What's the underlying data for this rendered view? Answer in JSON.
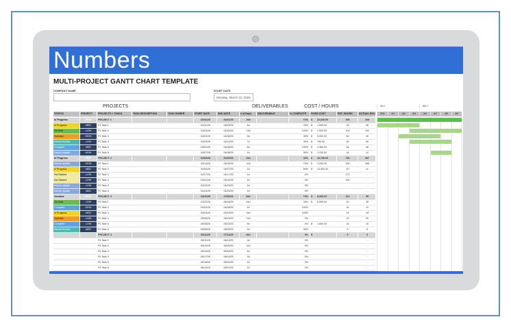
{
  "brand": {
    "title": "Numbers",
    "accent": "#2f6fd6"
  },
  "sheet": {
    "title": "MULTI-PROJECT GANTT CHART TEMPLATE",
    "company_label": "COMPANY NAME",
    "start_date_label": "START DATE",
    "start_date_value": "Monday, March 31, 2025"
  },
  "sections": {
    "projects": "PROJECTS",
    "deliverables": "DELIVERABLES",
    "cost_hours": "COST / HOURS"
  },
  "headers": [
    "STATUS",
    "PRIORITY",
    "PROJECTS + TASKS",
    "TASK DESCRIPTION",
    "TASK OWNER",
    "START DATE",
    "END DATE",
    "# of Days",
    "DELIVERABLE",
    "% COMPLETE",
    "FIXED COST",
    "EST. HOURS",
    "ACTUAL HOURS"
  ],
  "weeks": [
    "Wk 1",
    "Wk 2"
  ],
  "days": [
    "3/31",
    "4/1",
    "4/2",
    "4/3",
    "4/4",
    "4/7",
    "4/8",
    "4/9"
  ],
  "rows": [
    {
      "type": "project",
      "status": "In Progress",
      "st": "inprog",
      "priority": "HIGH",
      "name": "PROJECT 1",
      "start": "03/31/25",
      "end": "04/21/25",
      "days": "16d",
      "pct": "74%",
      "cur": "$",
      "cost": "22,630.00",
      "est": "306",
      "act": "298"
    },
    {
      "type": "task",
      "status": "In Progress",
      "st": "inprog",
      "priority": "MED",
      "name": "P1 Task 1",
      "start": "03/31/25",
      "end": "04/03/25",
      "days": "4d",
      "pct": "33%",
      "cur": "$",
      "cost": "1,500.00",
      "est": "32",
      "act": "36"
    },
    {
      "type": "task",
      "status": "On Hold",
      "st": "onhold",
      "priority": "LOW",
      "name": "P1 Task 2",
      "start": "04/03/25",
      "end": "04/20/25",
      "days": "13d",
      "pct": "100%",
      "cur": "$",
      "cost": "2,000.00",
      "est": "104",
      "act": "100"
    },
    {
      "type": "task",
      "status": "Overdue",
      "st": "overdue",
      "priority": "HIGH",
      "name": "P1 Task 3",
      "start": "04/02/25",
      "end": "04/08/25",
      "days": "5d",
      "pct": "90%",
      "cur": "$",
      "cost": "5,000.00",
      "est": "40",
      "act": "40"
    },
    {
      "type": "task",
      "status": "Needs Review",
      "st": "review",
      "priority": "LOW",
      "name": "P1 Task 4",
      "start": "04/03/25",
      "end": "04/12/25",
      "days": "7d",
      "pct": "33%",
      "cur": "$",
      "cost": "750.00",
      "est": "50",
      "act": "56"
    },
    {
      "type": "task",
      "status": "Complete",
      "st": "complete",
      "priority": "MED",
      "name": "P1 Task 5",
      "start": "04/02/25",
      "end": "04/08/25",
      "days": "8d",
      "pct": "100%",
      "cur": "$",
      "cost": "4,380.00",
      "est": "64",
      "act": "56"
    },
    {
      "type": "task",
      "status": "Needs Update",
      "st": "update",
      "priority": "HIGH",
      "name": "P1 Task 6",
      "start": "04/07/25",
      "end": "04/08/25",
      "days": "2d",
      "pct": "90%",
      "cur": "$",
      "cost": "1,200.00",
      "est": "16",
      "act": "10"
    },
    {
      "type": "project",
      "status": "In Progress",
      "st": "inprog",
      "priority": "MED",
      "name": "PROJECT 2",
      "start": "04/04/25",
      "end": "04/25/25",
      "days": "16d",
      "pct": "32%",
      "cur": "$",
      "cost": "16,700.00",
      "est": "792",
      "act": "367"
    },
    {
      "type": "task",
      "status": "Needs Update",
      "st": "update",
      "priority": "HIGH",
      "name": "P2 Task 1",
      "start": "04/14/25",
      "end": "04/25/25",
      "days": "10d",
      "pct": "75%",
      "cur": "$",
      "cost": "2,200.00",
      "est": "200",
      "act": "356"
    },
    {
      "type": "task",
      "status": "In Progress",
      "st": "inprog",
      "priority": "MED",
      "name": "P2 Task 2",
      "start": "04/04/25",
      "end": "04/07/25",
      "days": "2d",
      "pct": "60%",
      "cur": "$",
      "cost": "14,500.00",
      "est": "20",
      "act": "11"
    },
    {
      "type": "task",
      "status": "Not Started",
      "st": "notstarted",
      "priority": "LOW",
      "name": "P2 Task 3",
      "start": "04/17/25",
      "end": "04/17/25",
      "days": "1d",
      "pct": "0%",
      "cur": "",
      "cost": "",
      "est": "272",
      "act": "-"
    },
    {
      "type": "task",
      "status": "Not Started",
      "st": "notstarted",
      "priority": "LOW",
      "name": "P2 Task 4",
      "start": "04/21/25",
      "end": "04/24/25",
      "days": "4d",
      "pct": "0%",
      "cur": "",
      "cost": "",
      "est": "150",
      "act": "-"
    },
    {
      "type": "task",
      "status": "Needs Update",
      "st": "update",
      "priority": "LOW",
      "name": "P2 Task 5",
      "start": "04/22/25",
      "end": "04/23/25",
      "days": "2d",
      "pct": "0%",
      "cur": "",
      "cost": "",
      "est": "",
      "act": "-"
    },
    {
      "type": "task",
      "status": "Needs Update",
      "st": "update",
      "priority": "MED",
      "name": "P2 Task 6",
      "start": "04/24/25",
      "end": "04/25/25",
      "days": "2d",
      "pct": "0%",
      "cur": "",
      "cost": "",
      "est": "",
      "act": "-"
    },
    {
      "type": "project",
      "status": "Overdue",
      "st": "overdue",
      "priority": "HIGH",
      "name": "PROJECT 3",
      "start": "04/22/25",
      "end": "07/02/25",
      "days": "52d",
      "pct": "74%",
      "cur": "$",
      "cost": "8,300.00",
      "est": "112",
      "act": "99"
    },
    {
      "type": "task",
      "status": "On Hold",
      "st": "onhold",
      "priority": "LOW",
      "name": "P3 Task 1",
      "start": "04/22/25",
      "end": "06/18/25",
      "days": "44d",
      "pct": "33%",
      "cur": "$",
      "cost": "6,500.00",
      "est": "40",
      "act": "36"
    },
    {
      "type": "task",
      "status": "Complete",
      "st": "complete",
      "priority": "HIGH",
      "name": "P3 Task 2",
      "start": "04/03/25",
      "end": "04/08/25",
      "days": "2d",
      "pct": "100%",
      "cur": "",
      "cost": "",
      "est": "16",
      "act": "12"
    },
    {
      "type": "task",
      "status": "In Progress",
      "st": "inprog",
      "priority": "MED",
      "name": "P3 Task 3",
      "start": "04/04/25",
      "end": "05/19/25",
      "days": "34d",
      "pct": "100%",
      "cur": "",
      "cost": "",
      "est": "24",
      "act": "18"
    },
    {
      "type": "task",
      "status": "Overdue",
      "st": "overdue",
      "priority": "LOW",
      "name": "P3 Task 4",
      "start": "05/06/25",
      "end": "05/03/25",
      "days": "21d",
      "pct": "0%",
      "cur": "",
      "cost": "",
      "est": "32",
      "act": "32"
    },
    {
      "type": "task",
      "status": "Complete",
      "st": "complete",
      "priority": "LOW",
      "name": "P3 Task 5",
      "start": "05/08/25",
      "end": "05/23/25",
      "days": "5d",
      "pct": "0%",
      "cur": "$",
      "cost": "1,800.00",
      "est": "16",
      "act": "16"
    },
    {
      "type": "task",
      "status": "Needs Review",
      "st": "review",
      "priority": "MED",
      "name": "P3 Task 6",
      "start": "06/08/25",
      "end": "06/08/25",
      "days": "3d",
      "pct": "90%",
      "cur": "",
      "cost": "",
      "est": "5",
      "act": "8"
    },
    {
      "type": "project",
      "status": "",
      "st": "",
      "priority": "",
      "name": "PROJECT 4",
      "start": "06/11/25",
      "end": "07/14/25",
      "days": "46d",
      "pct": "0%",
      "cur": "$",
      "cost": "-",
      "est": "0",
      "act": "0"
    },
    {
      "type": "task",
      "status": "",
      "st": "",
      "priority": "",
      "name": "P4 Task 1",
      "start": "06/11/25",
      "end": "06/13/25",
      "days": "3d",
      "pct": "0%",
      "cur": "",
      "cost": "",
      "est": "",
      "act": "-"
    },
    {
      "type": "task",
      "status": "",
      "st": "",
      "priority": "",
      "name": "P4 Task 2",
      "start": "06/13/25",
      "end": "06/26/25",
      "days": "10d",
      "pct": "0%",
      "cur": "",
      "cost": "",
      "est": "",
      "act": "-"
    },
    {
      "type": "task",
      "status": "",
      "st": "",
      "priority": "",
      "name": "P4 Task 3",
      "start": "06/13/25",
      "end": "06/18/25",
      "days": "4d",
      "pct": "0%",
      "cur": "",
      "cost": "",
      "est": "",
      "act": "-"
    },
    {
      "type": "task",
      "status": "",
      "st": "",
      "priority": "",
      "name": "P4 Task 4",
      "start": "06/17/25",
      "end": "06/19/25",
      "days": "3d",
      "pct": "0%",
      "cur": "",
      "cost": "",
      "est": "",
      "act": "-"
    },
    {
      "type": "task",
      "status": "",
      "st": "",
      "priority": "",
      "name": "P4 Task 5",
      "start": "06/18/25",
      "end": "06/20/25",
      "days": "2d",
      "pct": "0%",
      "cur": "",
      "cost": "",
      "est": "",
      "act": "-"
    },
    {
      "type": "task",
      "status": "",
      "st": "",
      "priority": "",
      "name": "P4 Task 6",
      "start": "06/19/25",
      "end": "06/20/25",
      "days": "2d",
      "pct": "0%",
      "cur": "",
      "cost": "",
      "est": "",
      "act": "-"
    }
  ]
}
